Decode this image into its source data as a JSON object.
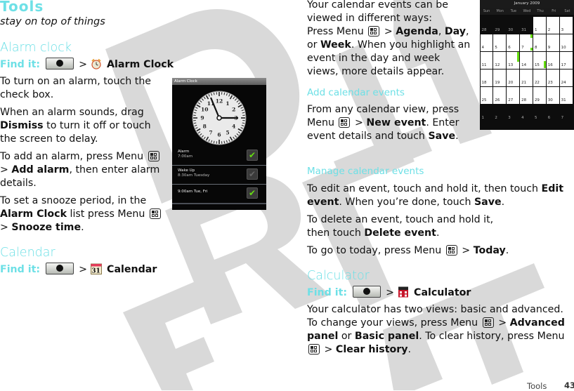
{
  "page": {
    "title": "Tools",
    "subtitle": "stay on top of things",
    "footer_section": "Tools",
    "footer_page": "43",
    "watermark": "DRAFT"
  },
  "alarm_clock": {
    "heading": "Alarm clock",
    "find_it_label": "Find it:",
    "find_it_sep": ">",
    "find_it_target": "Alarm Clock",
    "p1": "To turn on an alarm, touch the check box.",
    "p2_pre": "When an alarm sounds, drag ",
    "p2_bold": "Dismiss",
    "p2_post": " to turn it off or touch the screen to delay.",
    "p3_pre": "To add an alarm, press Menu",
    "p3_sep": ">",
    "p3_bold": "Add alarm",
    "p3_post": ", then enter alarm details.",
    "p4_pre": "To set a snooze period, in the ",
    "p4_bold1": "Alarm Clock",
    "p4_mid": " list press Menu",
    "p4_sep": ">",
    "p4_bold2": "Snooze time",
    "p4_post": ".",
    "screen": {
      "titlebar": "Alarm Clock",
      "clock_numbers": [
        "12",
        "1",
        "2",
        "3",
        "4",
        "5",
        "6",
        "7",
        "8",
        "9",
        "10",
        "11"
      ],
      "clock_time": "11:55 / 3:00",
      "alarms": [
        {
          "label": "Alarm",
          "time": "7:00am",
          "enabled": true
        },
        {
          "label": "Wake Up",
          "time": "8:30am Tuesday",
          "enabled": false
        },
        {
          "label": "9:00am Tue, Fri",
          "time": "",
          "enabled": true
        }
      ]
    }
  },
  "calendar": {
    "heading": "Calendar",
    "find_it_label": "Find it:",
    "find_it_sep": ">",
    "find_it_target": "Calendar",
    "intro_1": "Your calendar events can be viewed in different ways:",
    "intro_2_pre": "Press Menu",
    "intro_2_sep": ">",
    "intro_2_b1": "Agenda",
    "intro_2_c1": ", ",
    "intro_2_b2": "Day",
    "intro_2_c2": ", or ",
    "intro_2_b3": "Week",
    "intro_2_post": ". When you highlight an event in the day and week views, more details appear.",
    "add_heading": "Add calendar events",
    "add_pre": "From any calendar view, press Menu",
    "add_sep": ">",
    "add_b1": "New event",
    "add_mid": ". Enter event details and touch ",
    "add_b2": "Save",
    "add_post": ".",
    "manage_heading": "Manage calendar events",
    "edit_pre": "To edit an event, touch and hold it, then touch ",
    "edit_b1": "Edit event",
    "edit_mid": ". When you’re done, touch ",
    "edit_b2": "Save",
    "edit_post": ".",
    "delete_pre": "To delete an event, touch and hold it, then touch ",
    "delete_b": "Delete event",
    "delete_post": ".",
    "today_pre": "To go to today, press Menu",
    "today_sep": ">",
    "today_b": "Today",
    "today_post": ".",
    "screen": {
      "month_title": "January 2009",
      "weekdays": [
        "Sun",
        "Mon",
        "Tue",
        "Wed",
        "Thu",
        "Fri",
        "Sat"
      ],
      "weeks": [
        [
          "28",
          "29",
          "30",
          "31",
          "1",
          "2",
          "3"
        ],
        [
          "4",
          "5",
          "6",
          "7",
          "8",
          "9",
          "10"
        ],
        [
          "11",
          "12",
          "13",
          "14",
          "15",
          "16",
          "17"
        ],
        [
          "18",
          "19",
          "20",
          "21",
          "22",
          "23",
          "24"
        ],
        [
          "25",
          "26",
          "27",
          "28",
          "29",
          "30",
          "31"
        ],
        [
          "1",
          "2",
          "3",
          "4",
          "5",
          "6",
          "7"
        ]
      ],
      "event_days": [
        "7",
        "13",
        "15"
      ],
      "event_color": "#66dd11"
    }
  },
  "calculator": {
    "heading": "Calculator",
    "find_it_label": "Find it:",
    "find_it_sep": ">",
    "find_it_target": "Calculator",
    "p1": "Your calculator has two views: basic and advanced. To change your views, press Menu",
    "p1_sep": ">",
    "p1_b1": "Advanced panel",
    "p1_or": " or ",
    "p1_b2": "Basic panel",
    "p1_mid": ". To clear history, press Menu",
    "p1_sep2": ">",
    "p1_b3": "Clear history",
    "p1_post": "."
  },
  "colors": {
    "heading_accent": "#6ee0e6",
    "watermark": "#d9d9d9",
    "check_on": "#66dd11"
  }
}
